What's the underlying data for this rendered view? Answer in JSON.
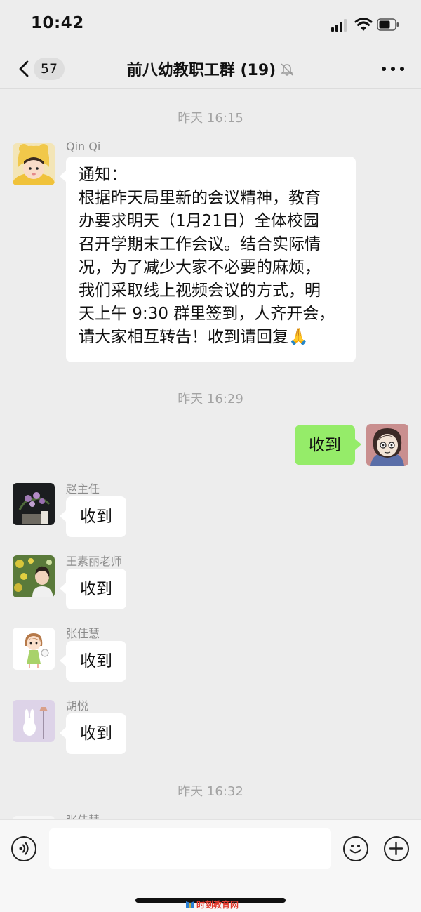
{
  "status_bar": {
    "time": "10:42"
  },
  "header": {
    "back_unread_count": "57",
    "title": "前八幼教职工群 (19)"
  },
  "messages": [
    {
      "type": "timestamp",
      "text": "昨天 16:15"
    },
    {
      "type": "incoming",
      "sender": "Qin Qi",
      "lines": [
        "通知：",
        "根据昨天局里新的会议精神，教育",
        "办要求明天（1月21日）全体校园",
        "召开学期末工作会议。结合实际情",
        "况，为了减少大家不必要的麻烦，",
        "我们采取线上视频会议的方式，明",
        "天上午 9:30 群里签到，人齐开会，",
        "请大家相互转告！收到请回复🙏"
      ]
    },
    {
      "type": "timestamp",
      "text": "昨天 16:29"
    },
    {
      "type": "outgoing",
      "text": "收到"
    },
    {
      "type": "incoming",
      "sender": "赵主任",
      "text": "收到"
    },
    {
      "type": "incoming",
      "sender": "王素丽老师",
      "text": "收到"
    },
    {
      "type": "incoming",
      "sender": "张佳慧",
      "text": "收到"
    },
    {
      "type": "incoming",
      "sender": "胡悦",
      "text": "收到"
    },
    {
      "type": "timestamp",
      "text": "昨天 16:32"
    },
    {
      "type": "incoming-partial",
      "sender": "张佳慧"
    }
  ],
  "input_bar": {
    "voice_icon": "voice-icon",
    "emoji_icon": "emoji-icon",
    "add_icon": "plus-icon",
    "text_value": ""
  },
  "watermark": {
    "text": "时刻教育网"
  }
}
